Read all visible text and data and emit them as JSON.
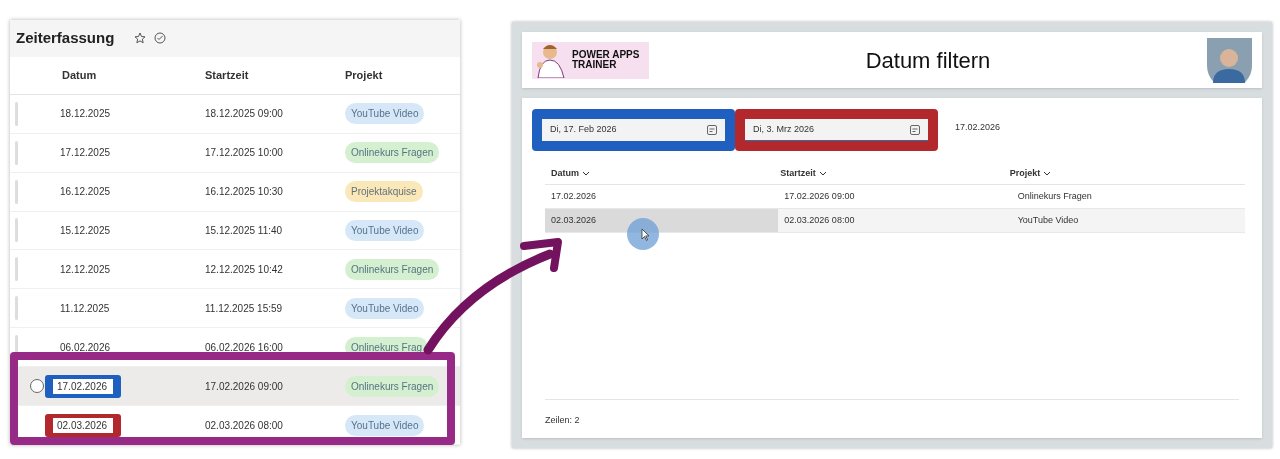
{
  "list_app": {
    "title": "Zeiterfassung",
    "columns": [
      "Datum",
      "Startzeit",
      "Projekt"
    ],
    "rows": [
      {
        "datum": "18.12.2025",
        "startzeit": "18.12.2025 09:00",
        "projekt": {
          "label": "YouTube Video",
          "color": "#d6e8f8"
        },
        "selected": false
      },
      {
        "datum": "17.12.2025",
        "startzeit": "17.12.2025 10:00",
        "projekt": {
          "label": "Onlinekurs Fragen",
          "color": "#d4f0d0"
        },
        "selected": false
      },
      {
        "datum": "16.12.2025",
        "startzeit": "16.12.2025 10:30",
        "projekt": {
          "label": "Projektakquise",
          "color": "#fbe8b8"
        },
        "selected": false
      },
      {
        "datum": "15.12.2025",
        "startzeit": "15.12.2025 11:40",
        "projekt": {
          "label": "YouTube Video",
          "color": "#d6e8f8"
        },
        "selected": false
      },
      {
        "datum": "12.12.2025",
        "startzeit": "12.12.2025 10:42",
        "projekt": {
          "label": "Onlinekurs Fragen",
          "color": "#d4f0d0"
        },
        "selected": false
      },
      {
        "datum": "11.12.2025",
        "startzeit": "11.12.2025 15:59",
        "projekt": {
          "label": "YouTube Video",
          "color": "#d6e8f8"
        },
        "selected": false
      },
      {
        "datum": "06.02.2026",
        "startzeit": "06.02.2026 16:00",
        "projekt": {
          "label": "Onlinekurs Frag",
          "color": "#d4f0d0"
        },
        "selected": false
      },
      {
        "datum": "17.02.2026",
        "startzeit": "17.02.2026 09:00",
        "projekt": {
          "label": "Onlinekurs Fragen",
          "color": "#d4f0d0"
        },
        "selected": true,
        "color": "#1f5fbf"
      },
      {
        "datum": "02.03.2026",
        "startzeit": "02.03.2026 08:00",
        "projekt": {
          "label": "YouTube Video",
          "color": "#d6e8f8"
        },
        "selected": false,
        "color": "#b3282d"
      }
    ]
  },
  "filter_app": {
    "logo_text": "POWER APPS TRAINER",
    "title": "Datum filtern",
    "date_pickers": [
      {
        "value": "Di, 17. Feb 2026",
        "focused": false,
        "color": "#1f5fbf"
      },
      {
        "value": "Di, 3. Mrz 2026",
        "focused": true,
        "color": "#b3282d"
      }
    ],
    "selected_date": "17.02.2026",
    "columns": [
      "Datum",
      "Startzeit",
      "Projekt"
    ],
    "rows": [
      {
        "cells": [
          "17.02.2026",
          "17.02.2026 09:00",
          "Onlinekurs Fragen"
        ],
        "hovered": false
      },
      {
        "cells": [
          "02.03.2026",
          "02.03.2026 08:00",
          "YouTube Video"
        ],
        "hovered": true
      }
    ],
    "row_count": "Zeilen: 2"
  }
}
